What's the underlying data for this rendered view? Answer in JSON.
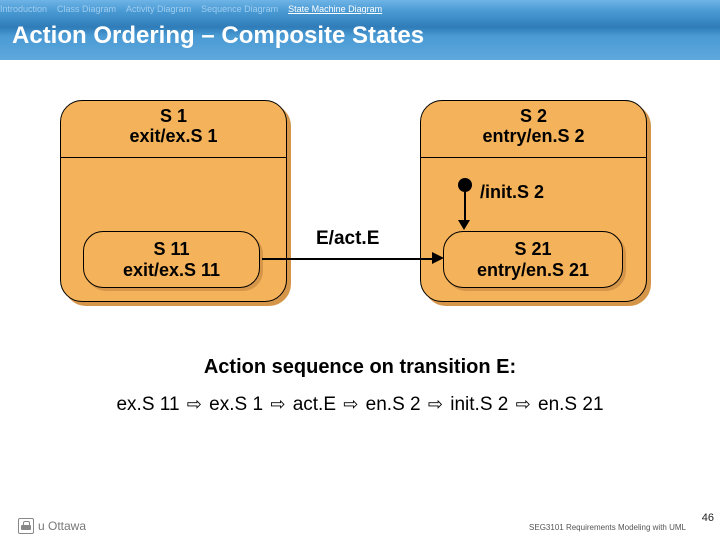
{
  "tabs": {
    "introduction": "Introduction",
    "class": "Class Diagram",
    "activity": "Activity Diagram",
    "sequence": "Sequence Diagram",
    "statemachine": "State Machine Diagram"
  },
  "title": "Action Ordering – Composite States",
  "s1": {
    "name": "S 1",
    "exit": "exit/ex.S 1"
  },
  "s2": {
    "name": "S 2",
    "entry": "entry/en.S 2"
  },
  "s11": {
    "name": "S 11",
    "exit": "exit/ex.S 11"
  },
  "s21": {
    "name": "S 21",
    "entry": "entry/en.S 21"
  },
  "transition": {
    "label": "E/act.E"
  },
  "init": {
    "label": "/init.S 2"
  },
  "sequence_title": "Action sequence on transition E:",
  "sequence_items": {
    "a": "ex.S 11",
    "b": "ex.S 1",
    "c": "act.E",
    "d": "en.S 2",
    "e": "init.S 2",
    "f": "en.S 21"
  },
  "footer": {
    "org": "u Ottawa",
    "course": "SEG3101  Requirements  Modeling with UML",
    "slide": "46"
  }
}
